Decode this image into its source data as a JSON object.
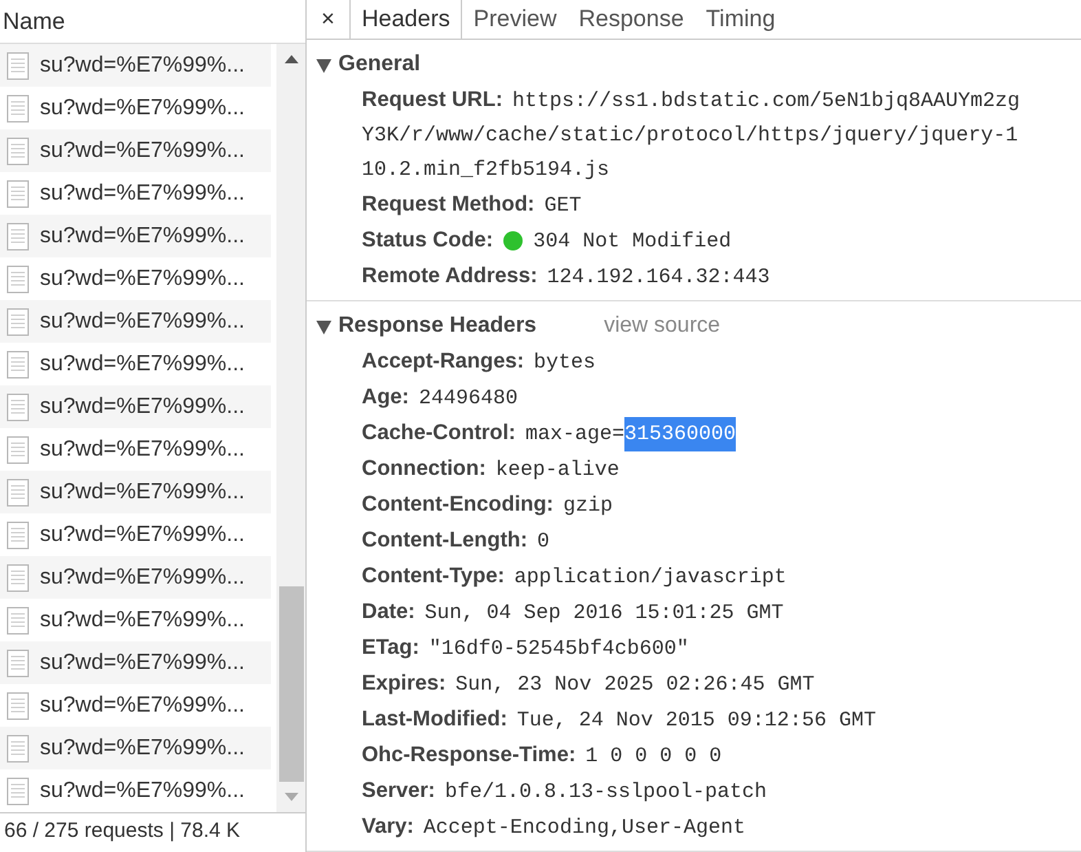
{
  "request_list": {
    "header": "Name",
    "rows": [
      {
        "name": "su?wd=%E7%99%..."
      },
      {
        "name": "su?wd=%E7%99%..."
      },
      {
        "name": "su?wd=%E7%99%..."
      },
      {
        "name": "su?wd=%E7%99%..."
      },
      {
        "name": "su?wd=%E7%99%..."
      },
      {
        "name": "su?wd=%E7%99%..."
      },
      {
        "name": "su?wd=%E7%99%..."
      },
      {
        "name": "su?wd=%E7%99%..."
      },
      {
        "name": "su?wd=%E7%99%..."
      },
      {
        "name": "su?wd=%E7%99%..."
      },
      {
        "name": "su?wd=%E7%99%..."
      },
      {
        "name": "su?wd=%E7%99%..."
      },
      {
        "name": "su?wd=%E7%99%..."
      },
      {
        "name": "su?wd=%E7%99%..."
      },
      {
        "name": "su?wd=%E7%99%..."
      },
      {
        "name": "su?wd=%E7%99%..."
      },
      {
        "name": "su?wd=%E7%99%..."
      },
      {
        "name": "su?wd=%E7%99%..."
      }
    ],
    "status_bar": "66 / 275 requests | 78.4 K"
  },
  "details": {
    "close": "×",
    "tabs": [
      {
        "label": "Headers",
        "selected": true
      },
      {
        "label": "Preview",
        "selected": false
      },
      {
        "label": "Response",
        "selected": false
      },
      {
        "label": "Timing",
        "selected": false
      }
    ],
    "sections": [
      {
        "title": "General",
        "expanded": true,
        "rows": [
          {
            "name": "Request URL:",
            "kind": "multiline",
            "lines": [
              "https://ss1.bdstatic.com/5eN1bjq8AAUYm2zg",
              "Y3K/r/www/cache/static/protocol/https/jquery/jquery-1",
              "10.2.min_f2fb5194.js"
            ]
          },
          {
            "name": "Request Method:",
            "kind": "text",
            "value": "GET"
          },
          {
            "name": "Status Code:",
            "kind": "status",
            "color": "#2ec12e",
            "value": "304 Not Modified"
          },
          {
            "name": "Remote Address:",
            "kind": "text",
            "value": "124.192.164.32:443"
          }
        ]
      },
      {
        "title": "Response Headers",
        "expanded": true,
        "link": "view source",
        "rows": [
          {
            "name": "Accept-Ranges:",
            "kind": "text",
            "value": "bytes"
          },
          {
            "name": "Age:",
            "kind": "text",
            "value": "24496480"
          },
          {
            "name": "Cache-Control:",
            "kind": "selection",
            "value": "max-age=",
            "selection": "315360000"
          },
          {
            "name": "Connection:",
            "kind": "text",
            "value": "keep-alive"
          },
          {
            "name": "Content-Encoding:",
            "kind": "text",
            "value": "gzip"
          },
          {
            "name": "Content-Length:",
            "kind": "text",
            "value": "0"
          },
          {
            "name": "Content-Type:",
            "kind": "text",
            "value": "application/javascript"
          },
          {
            "name": "Date:",
            "kind": "text",
            "value": "Sun, 04 Sep 2016 15:01:25 GMT"
          },
          {
            "name": "ETag:",
            "kind": "text",
            "value": "\"16df0-52545bf4cb600\""
          },
          {
            "name": "Expires:",
            "kind": "text",
            "value": "Sun, 23 Nov 2025 02:26:45 GMT"
          },
          {
            "name": "Last-Modified:",
            "kind": "text",
            "value": "Tue, 24 Nov 2015 09:12:56 GMT"
          },
          {
            "name": "Ohc-Response-Time:",
            "kind": "text",
            "value": "1 0 0 0 0 0"
          },
          {
            "name": "Server:",
            "kind": "text",
            "value": "bfe/1.0.8.13-sslpool-patch"
          },
          {
            "name": "Vary:",
            "kind": "text",
            "value": "Accept-Encoding,User-Agent"
          }
        ]
      }
    ]
  }
}
